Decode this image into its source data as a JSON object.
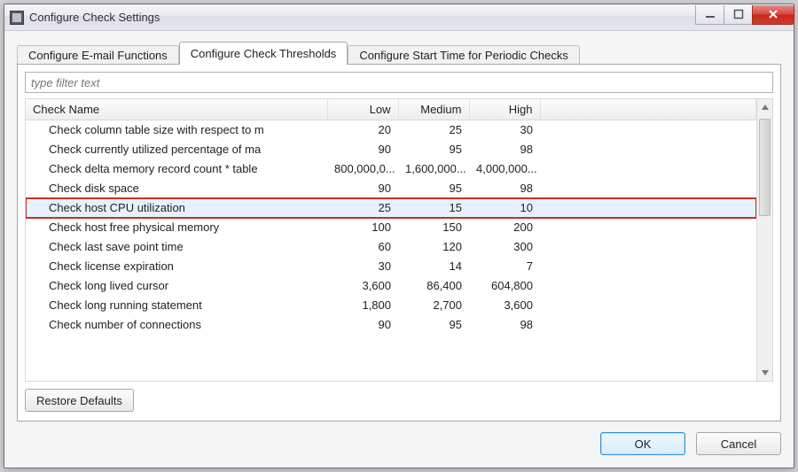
{
  "window": {
    "title": "Configure Check Settings"
  },
  "tabs": [
    {
      "label": "Configure E-mail Functions",
      "active": false
    },
    {
      "label": "Configure Check Thresholds",
      "active": true
    },
    {
      "label": "Configure Start Time for Periodic Checks",
      "active": false
    }
  ],
  "filter": {
    "placeholder": "type filter text",
    "value": ""
  },
  "columns": {
    "name": "Check Name",
    "low": "Low",
    "medium": "Medium",
    "high": "High"
  },
  "rows": [
    {
      "name": "Check column table size with respect to m",
      "low": "20",
      "medium": "25",
      "high": "30",
      "selected": false
    },
    {
      "name": "Check currently utilized percentage of ma",
      "low": "90",
      "medium": "95",
      "high": "98",
      "selected": false
    },
    {
      "name": "Check delta memory record count * table",
      "low": "800,000,0...",
      "medium": "1,600,000...",
      "high": "4,000,000...",
      "selected": false
    },
    {
      "name": "Check disk space",
      "low": "90",
      "medium": "95",
      "high": "98",
      "selected": false
    },
    {
      "name": "Check host CPU utilization",
      "low": "25",
      "medium": "15",
      "high": "10",
      "selected": true
    },
    {
      "name": "Check host free physical memory",
      "low": "100",
      "medium": "150",
      "high": "200",
      "selected": false
    },
    {
      "name": "Check last save point time",
      "low": "60",
      "medium": "120",
      "high": "300",
      "selected": false
    },
    {
      "name": "Check license expiration",
      "low": "30",
      "medium": "14",
      "high": "7",
      "selected": false
    },
    {
      "name": "Check long lived cursor",
      "low": "3,600",
      "medium": "86,400",
      "high": "604,800",
      "selected": false
    },
    {
      "name": "Check long running statement",
      "low": "1,800",
      "medium": "2,700",
      "high": "3,600",
      "selected": false
    },
    {
      "name": "Check number of connections",
      "low": "90",
      "medium": "95",
      "high": "98",
      "selected": false
    }
  ],
  "buttons": {
    "restore": "Restore Defaults",
    "ok": "OK",
    "cancel": "Cancel"
  }
}
